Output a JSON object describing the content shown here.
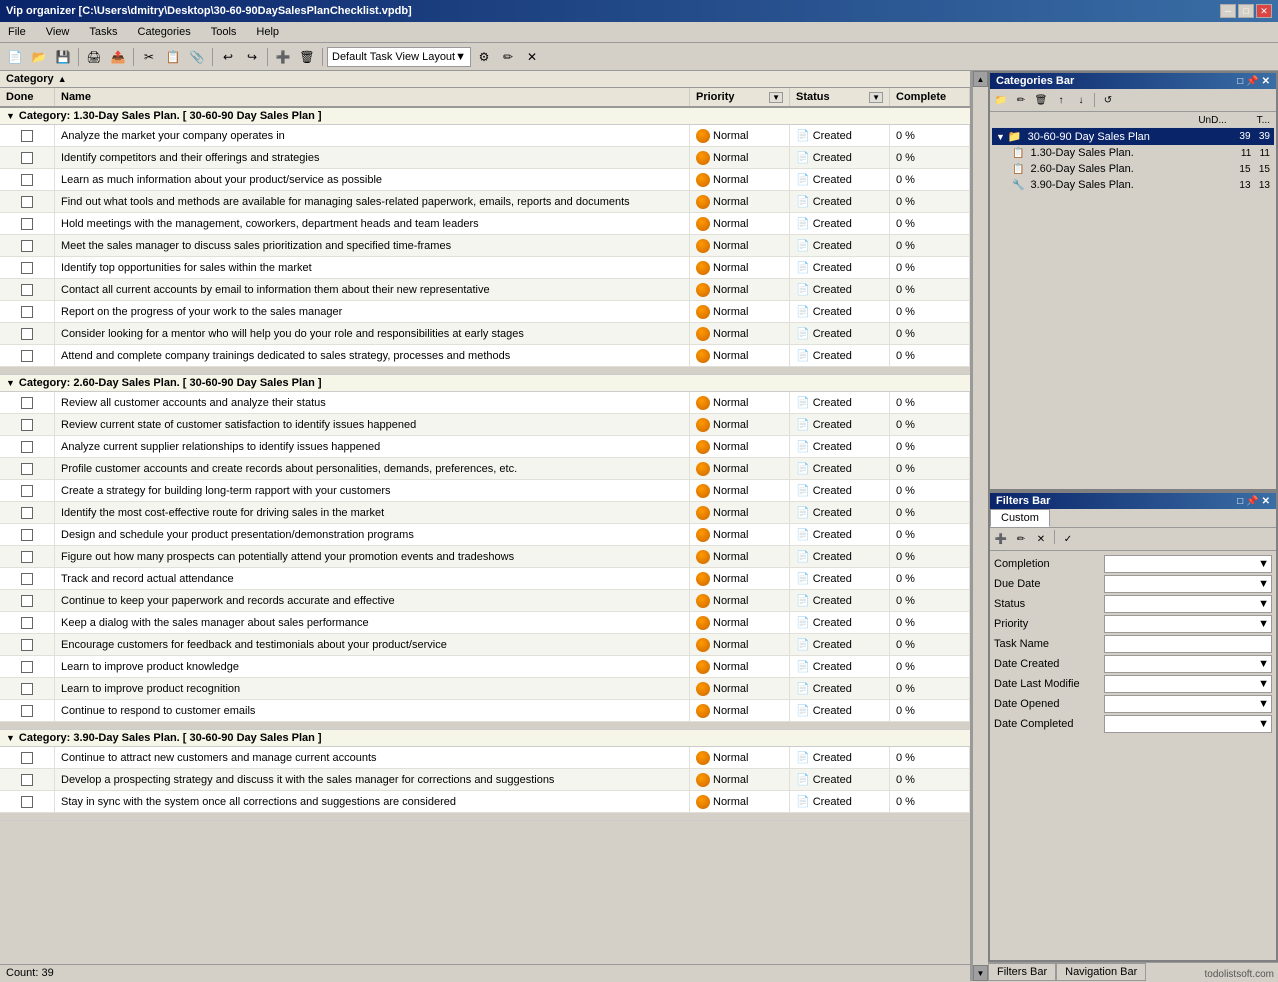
{
  "window": {
    "title": "Vip organizer [C:\\Users\\dmitry\\Desktop\\30-60-90DaySalesPlanChecklist.vpdb]",
    "minimize": "─",
    "maximize": "□",
    "close": "✕"
  },
  "menu": {
    "items": [
      "File",
      "View",
      "Tasks",
      "Categories",
      "Tools",
      "Help"
    ]
  },
  "toolbar": {
    "layout_label": "Default Task View Layout"
  },
  "category_header": {
    "label": "Category",
    "sort_arrow": "▲"
  },
  "columns": {
    "done": "Done",
    "name": "Name",
    "priority": "Priority",
    "status": "Status",
    "complete": "Complete"
  },
  "categories": [
    {
      "id": "cat1",
      "label": "Category: 1.30-Day Sales Plan.   [ 30-60-90 Day Sales Plan ]",
      "tasks": [
        {
          "name": "Analyze the market your company operates in",
          "priority": "Normal",
          "status": "Created",
          "complete": "0 %"
        },
        {
          "name": "Identify competitors and their offerings and strategies",
          "priority": "Normal",
          "status": "Created",
          "complete": "0 %"
        },
        {
          "name": "Learn as much information about your product/service as possible",
          "priority": "Normal",
          "status": "Created",
          "complete": "0 %"
        },
        {
          "name": "Find out what tools and methods are available for managing sales-related paperwork, emails, reports and documents",
          "priority": "Normal",
          "status": "Created",
          "complete": "0 %"
        },
        {
          "name": "Hold meetings with the management, coworkers, department heads and team leaders",
          "priority": "Normal",
          "status": "Created",
          "complete": "0 %"
        },
        {
          "name": "Meet the sales manager to discuss sales prioritization and specified time-frames",
          "priority": "Normal",
          "status": "Created",
          "complete": "0 %"
        },
        {
          "name": "Identify top  opportunities for sales within the market",
          "priority": "Normal",
          "status": "Created",
          "complete": "0 %"
        },
        {
          "name": "Contact all current accounts by email to information them about their new representative",
          "priority": "Normal",
          "status": "Created",
          "complete": "0 %"
        },
        {
          "name": "Report on the progress of your work to the sales manager",
          "priority": "Normal",
          "status": "Created",
          "complete": "0 %"
        },
        {
          "name": "Consider looking for a mentor who will help you do your role and responsibilities at early stages",
          "priority": "Normal",
          "status": "Created",
          "complete": "0 %"
        },
        {
          "name": "Attend and complete company trainings dedicated to sales strategy, processes and methods",
          "priority": "Normal",
          "status": "Created",
          "complete": "0 %"
        }
      ]
    },
    {
      "id": "cat2",
      "label": "Category: 2.60-Day Sales Plan.   [ 30-60-90 Day Sales Plan ]",
      "tasks": [
        {
          "name": "Review all  customer accounts and analyze their status",
          "priority": "Normal",
          "status": "Created",
          "complete": "0 %"
        },
        {
          "name": "Review current state of customer satisfaction  to identify issues happened",
          "priority": "Normal",
          "status": "Created",
          "complete": "0 %"
        },
        {
          "name": "Analyze current supplier relationships to identify issues happened",
          "priority": "Normal",
          "status": "Created",
          "complete": "0 %"
        },
        {
          "name": "Profile customer accounts and create records about personalities, demands, preferences, etc.",
          "priority": "Normal",
          "status": "Created",
          "complete": "0 %"
        },
        {
          "name": "Create a strategy for building long-term rapport with your customers",
          "priority": "Normal",
          "status": "Created",
          "complete": "0 %"
        },
        {
          "name": "Identify the most cost-effective route for driving sales in the market",
          "priority": "Normal",
          "status": "Created",
          "complete": "0 %"
        },
        {
          "name": "Design and schedule your product presentation/demonstration programs",
          "priority": "Normal",
          "status": "Created",
          "complete": "0 %"
        },
        {
          "name": "Figure out how many prospects can potentially attend your promotion events and tradeshows",
          "priority": "Normal",
          "status": "Created",
          "complete": "0 %"
        },
        {
          "name": "Track and record actual attendance",
          "priority": "Normal",
          "status": "Created",
          "complete": "0 %"
        },
        {
          "name": "Continue to keep your paperwork and records accurate and effective",
          "priority": "Normal",
          "status": "Created",
          "complete": "0 %"
        },
        {
          "name": "Keep a dialog with the sales manager about sales performance",
          "priority": "Normal",
          "status": "Created",
          "complete": "0 %"
        },
        {
          "name": "Encourage customers for feedback and testimonials about your product/service",
          "priority": "Normal",
          "status": "Created",
          "complete": "0 %"
        },
        {
          "name": "Learn to improve product knowledge",
          "priority": "Normal",
          "status": "Created",
          "complete": "0 %"
        },
        {
          "name": "Learn to improve product recognition",
          "priority": "Normal",
          "status": "Created",
          "complete": "0 %"
        },
        {
          "name": "Continue to respond to customer emails",
          "priority": "Normal",
          "status": "Created",
          "complete": "0 %"
        }
      ]
    },
    {
      "id": "cat3",
      "label": "Category: 3.90-Day Sales Plan.   [ 30-60-90 Day Sales Plan ]",
      "tasks": [
        {
          "name": "Continue to attract new customers and manage current accounts",
          "priority": "Normal",
          "status": "Created",
          "complete": "0 %"
        },
        {
          "name": "Develop a prospecting strategy and discuss it with the sales manager for corrections and suggestions",
          "priority": "Normal",
          "status": "Created",
          "complete": "0 %"
        },
        {
          "name": "Stay in sync with the system once all corrections and suggestions are considered",
          "priority": "Normal",
          "status": "Created",
          "complete": "0 %"
        }
      ]
    }
  ],
  "categories_bar": {
    "title": "Categories Bar",
    "col1": "UnD...",
    "col2": "T...",
    "items": [
      {
        "label": "30-60-90 Day Sales Plan",
        "count1": "39",
        "count2": "39",
        "indent": 0,
        "expanded": true
      },
      {
        "label": "1.30-Day Sales Plan.",
        "count1": "11",
        "count2": "11",
        "indent": 1
      },
      {
        "label": "2.60-Day Sales Plan.",
        "count1": "15",
        "count2": "15",
        "indent": 1
      },
      {
        "label": "3.90-Day Sales Plan.",
        "count1": "13",
        "count2": "13",
        "indent": 1
      }
    ]
  },
  "filters_bar": {
    "title": "Filters Bar",
    "tabs": [
      "Custom"
    ],
    "filters": [
      {
        "label": "Completion",
        "type": "dropdown"
      },
      {
        "label": "Due Date",
        "type": "dropdown"
      },
      {
        "label": "Status",
        "type": "dropdown"
      },
      {
        "label": "Priority",
        "type": "dropdown"
      },
      {
        "label": "Task Name",
        "type": "text"
      },
      {
        "label": "Date Created",
        "type": "dropdown"
      },
      {
        "label": "Date Last Modifie",
        "type": "dropdown"
      },
      {
        "label": "Date Opened",
        "type": "dropdown"
      },
      {
        "label": "Date Completed",
        "type": "dropdown"
      }
    ]
  },
  "bottom": {
    "count_label": "Count: 39"
  },
  "right_tabs": [
    "Filters Bar",
    "Navigation Bar"
  ],
  "watermark": "todolistsoft.com"
}
